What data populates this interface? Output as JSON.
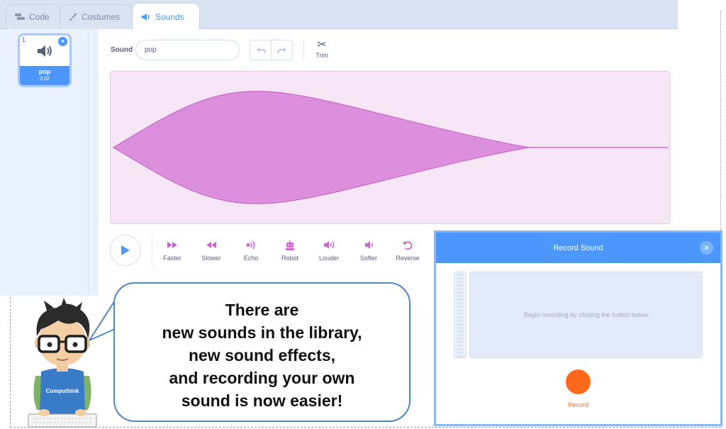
{
  "tabs": [
    {
      "label": "Code",
      "icon": "code-blocks-icon"
    },
    {
      "label": "Costumes",
      "icon": "paintbrush-icon"
    },
    {
      "label": "Sounds",
      "icon": "speaker-icon"
    }
  ],
  "sound_list": {
    "items": [
      {
        "index": "1",
        "name": "pop",
        "duration": "0.02"
      }
    ]
  },
  "editor": {
    "sound_label": "Sound",
    "sound_name": "pop",
    "trim_label": "Trim"
  },
  "effects": [
    {
      "label": "Faster",
      "icon": "faster-icon"
    },
    {
      "label": "Slower",
      "icon": "slower-icon"
    },
    {
      "label": "Echo",
      "icon": "echo-icon"
    },
    {
      "label": "Robot",
      "icon": "robot-icon"
    },
    {
      "label": "Louder",
      "icon": "louder-icon"
    },
    {
      "label": "Softer",
      "icon": "softer-icon"
    },
    {
      "label": "Reverse",
      "icon": "reverse-icon"
    }
  ],
  "record_dialog": {
    "title": "Record Sound",
    "hint": "Begin recording by clicking the button below",
    "record_label": "Record"
  },
  "bubble": {
    "lines": [
      "There are",
      "new sounds in the library,",
      "new sound effects,",
      "and recording your own",
      "sound is now easier!"
    ]
  },
  "character": {
    "shirt_text": "Computhink"
  },
  "colors": {
    "accent": "#4c97ff",
    "waveform": "#cf63cf",
    "record": "#ff6a1a",
    "bubble_border": "#4f86c8"
  }
}
